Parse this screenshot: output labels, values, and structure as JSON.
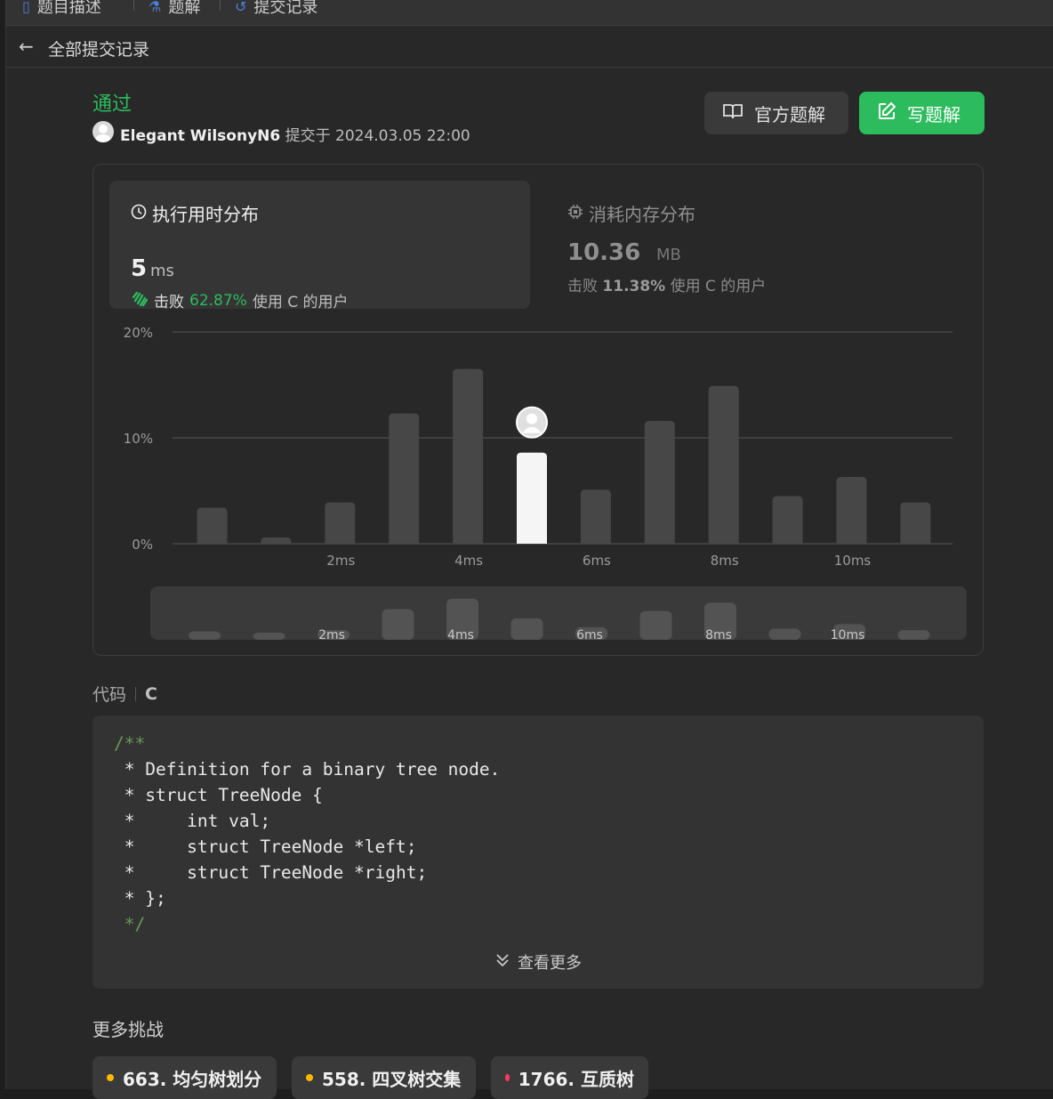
{
  "tabs": [
    {
      "label": "题目描述",
      "icon": "description-icon"
    },
    {
      "label": "题解",
      "icon": "solutions-icon"
    },
    {
      "label": "提交记录",
      "icon": "history-icon"
    }
  ],
  "subheader": {
    "title": "全部提交记录"
  },
  "submission": {
    "status": "通过",
    "username": "Elegant WilsonyN6",
    "submitted_prefix": "提交于",
    "submitted_at": "2024.03.05 22:00"
  },
  "buttons": {
    "official": "官方题解",
    "write": "写题解"
  },
  "stats": {
    "runtime": {
      "title": "执行用时分布",
      "value": "5",
      "unit": "ms",
      "beat_label": "击败",
      "beat_pct": "62.87%",
      "beat_suffix": "使用 C 的用户"
    },
    "memory": {
      "title": "消耗内存分布",
      "value": "10.36",
      "unit": "MB",
      "beat_label": "击败",
      "beat_pct": "11.38%",
      "beat_suffix": "使用 C 的用户"
    }
  },
  "chart_data": {
    "type": "bar",
    "y_tick_labels": [
      "20%",
      "10%",
      "0%"
    ],
    "x_tick_labels": [
      "2ms",
      "4ms",
      "6ms",
      "8ms",
      "10ms"
    ],
    "ylim": [
      0,
      20
    ],
    "grid": true,
    "values": [
      3.4,
      0.6,
      3.9,
      12.3,
      16.5,
      8.6,
      5.1,
      11.6,
      14.9,
      4.5,
      6.3,
      3.9
    ],
    "highlight_index": 5,
    "colors": {
      "bar": "#474747",
      "highlight": "#f5f5f5",
      "grid": "#474747",
      "overview_bg": "#3a3a3a",
      "overview_bar": "#535353"
    }
  },
  "code": {
    "label": "代码",
    "language": "C",
    "lines": [
      "/**",
      " * Definition for a binary tree node.",
      " * struct TreeNode {",
      " *     int val;",
      " *     struct TreeNode *left;",
      " *     struct TreeNode *right;",
      " * };",
      " */"
    ],
    "show_more": "查看更多"
  },
  "challenges": {
    "title": "更多挑战",
    "items": [
      {
        "label": "663. 均匀树划分",
        "color": "#ffb800"
      },
      {
        "label": "558. 四叉树交集",
        "color": "#ffb800"
      },
      {
        "label": "1766. 互质树",
        "color": "#ff375f"
      }
    ]
  }
}
